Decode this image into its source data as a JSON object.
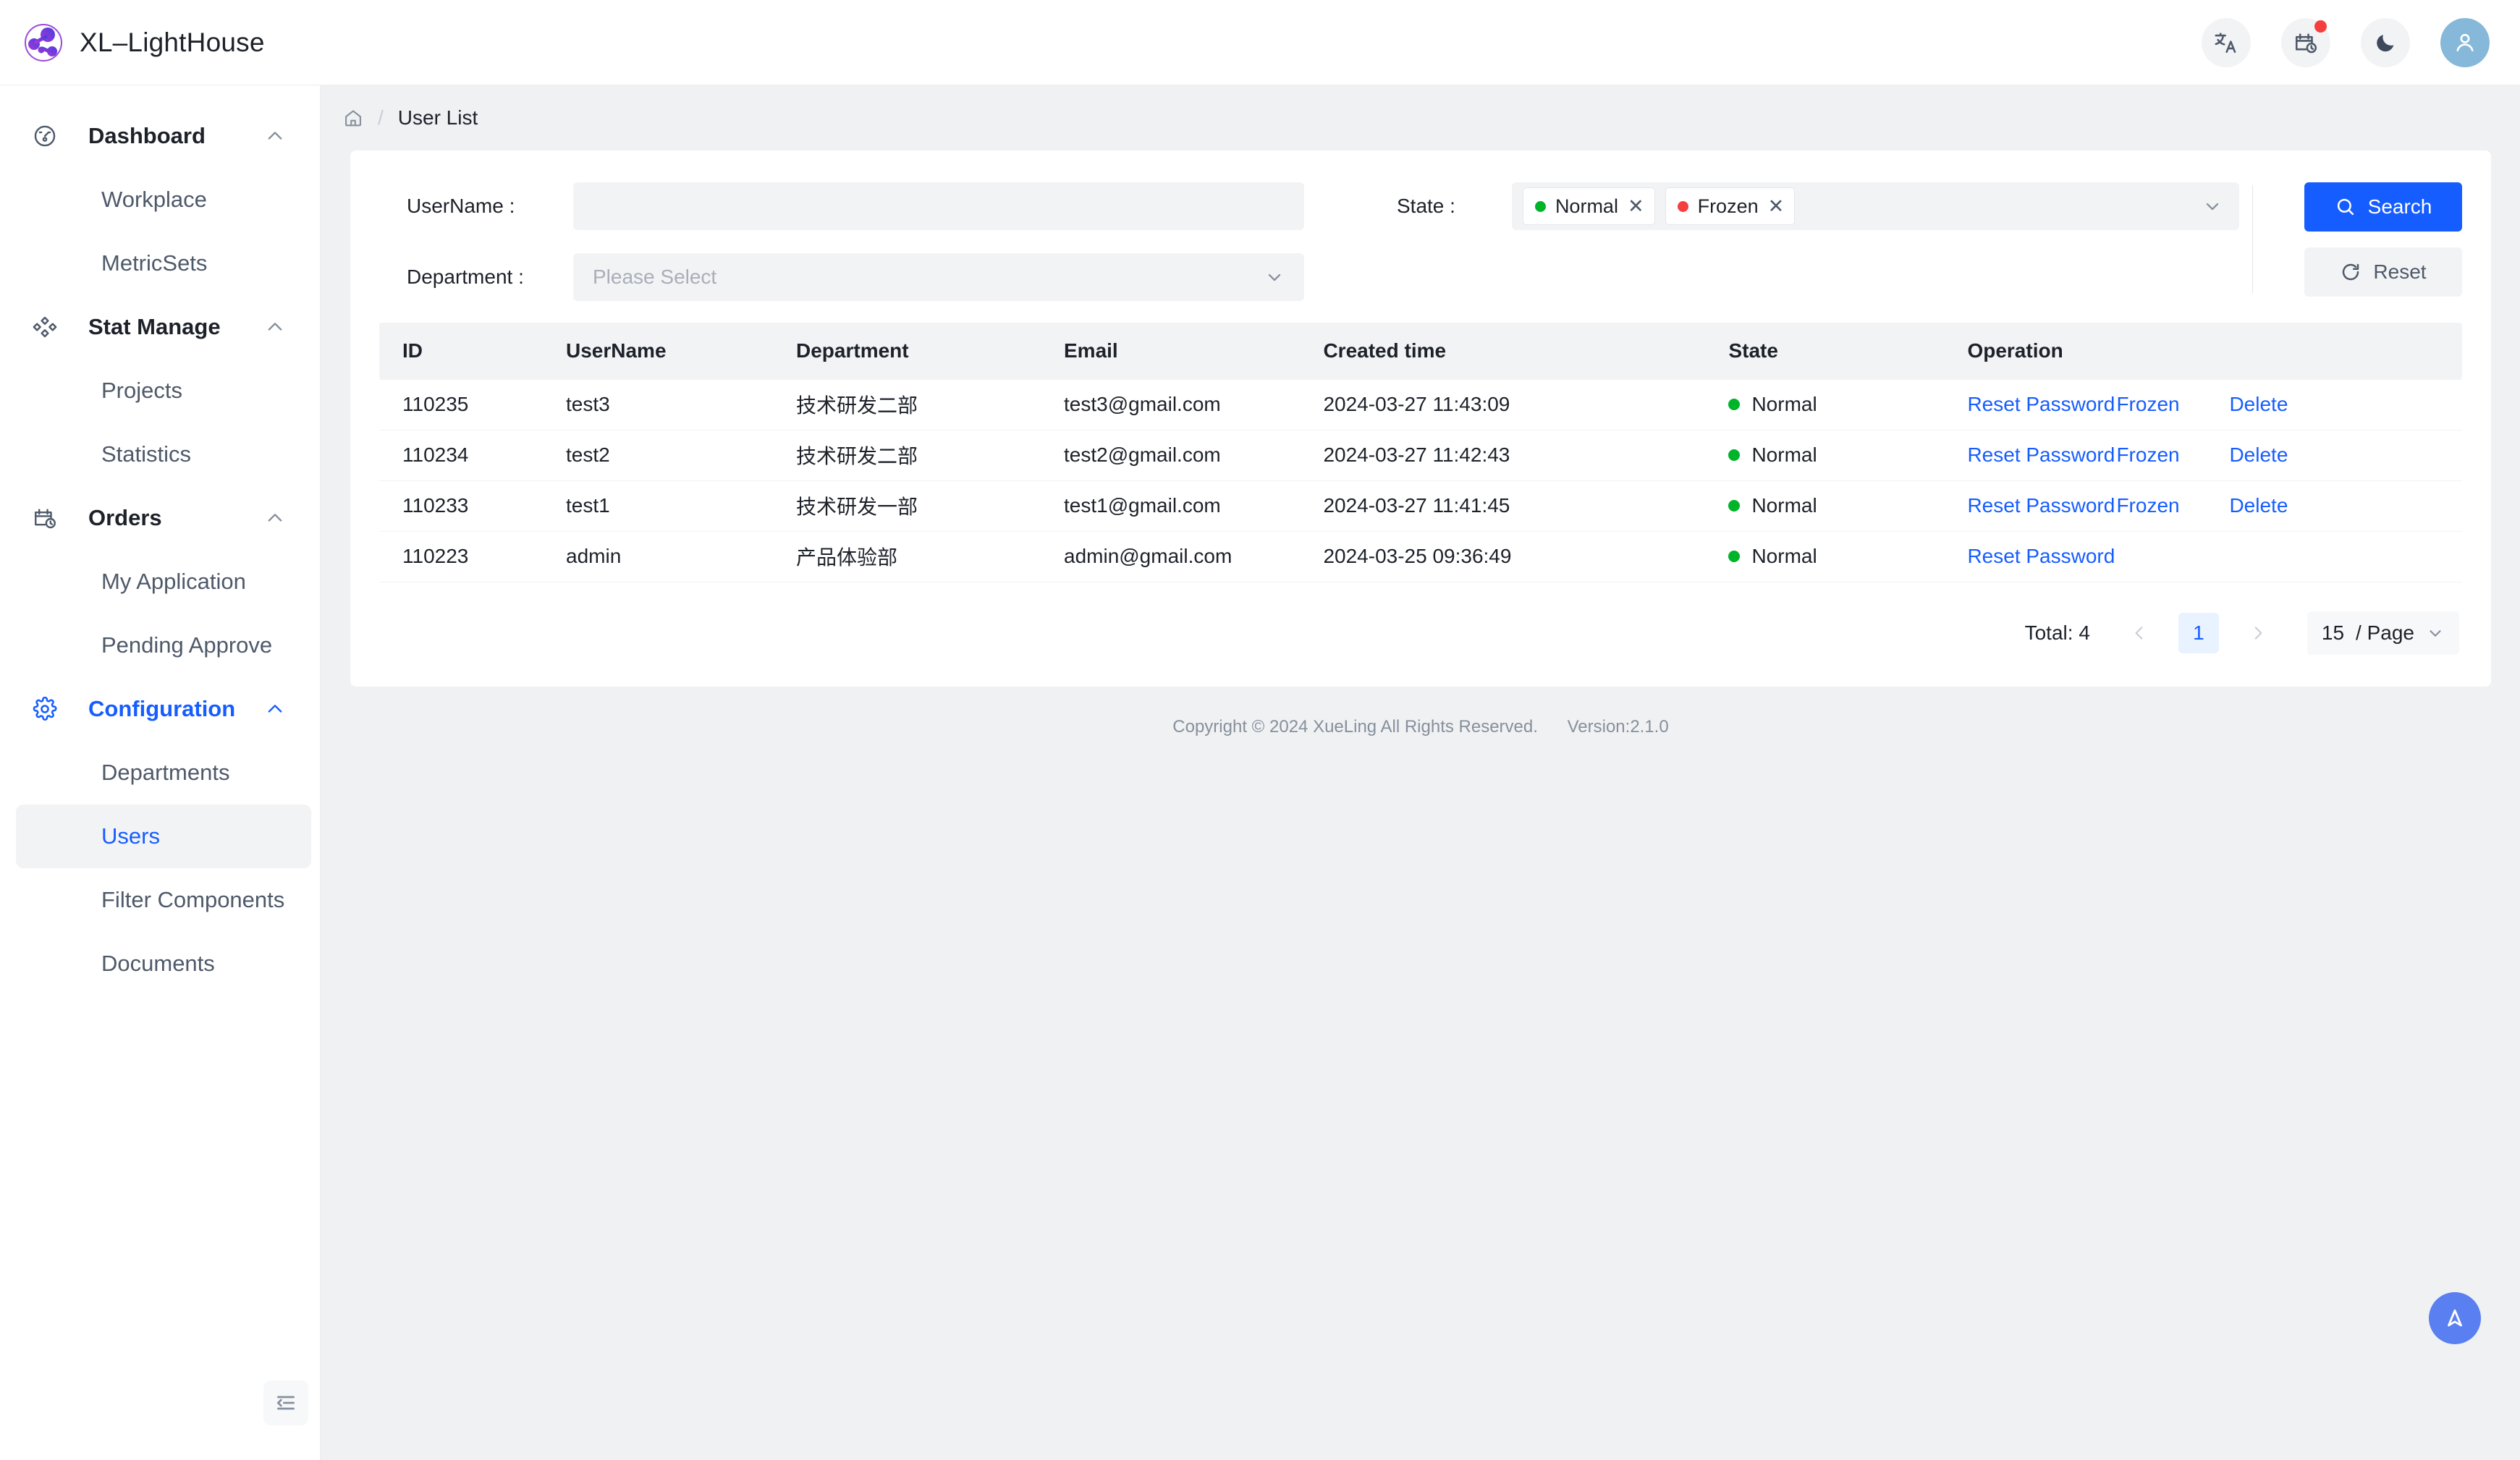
{
  "app": {
    "brand_title": "XL–LightHouse"
  },
  "header": {
    "icons": [
      {
        "name": "translate-icon"
      },
      {
        "name": "calendar-clock-icon",
        "has_badge": true
      },
      {
        "name": "moon-icon"
      },
      {
        "name": "user-avatar-icon"
      }
    ]
  },
  "sidebar": {
    "groups": [
      {
        "label": "Dashboard",
        "icon": "dashboard-icon",
        "active": false,
        "items": [
          {
            "label": "Workplace",
            "active": false
          },
          {
            "label": "MetricSets",
            "active": false
          }
        ]
      },
      {
        "label": "Stat Manage",
        "icon": "stat-manage-icon",
        "active": false,
        "items": [
          {
            "label": "Projects",
            "active": false
          },
          {
            "label": "Statistics",
            "active": false
          }
        ]
      },
      {
        "label": "Orders",
        "icon": "orders-icon",
        "active": false,
        "items": [
          {
            "label": "My Application",
            "active": false
          },
          {
            "label": "Pending Approve",
            "active": false
          }
        ]
      },
      {
        "label": "Configuration",
        "icon": "gear-icon",
        "active": true,
        "items": [
          {
            "label": "Departments",
            "active": false
          },
          {
            "label": "Users",
            "active": true
          },
          {
            "label": "Filter Components",
            "active": false
          },
          {
            "label": "Documents",
            "active": false
          }
        ]
      }
    ],
    "collapse_icon": "menu-fold-icon"
  },
  "breadcrumb": {
    "home_icon": "home-icon",
    "separator": "/",
    "current": "User List"
  },
  "filter": {
    "username": {
      "label": "UserName :",
      "value": "",
      "placeholder": ""
    },
    "department": {
      "label": "Department :",
      "value": "",
      "placeholder": "Please Select"
    },
    "state": {
      "label": "State :",
      "tags": [
        {
          "label": "Normal",
          "dot_color": "#00b42a",
          "close": "✕"
        },
        {
          "label": "Frozen",
          "dot_color": "#f53f3f",
          "close": "✕"
        }
      ]
    },
    "search_button": "Search",
    "reset_button": "Reset"
  },
  "table": {
    "columns": [
      "ID",
      "UserName",
      "Department",
      "Email",
      "Created time",
      "State",
      "Operation"
    ],
    "rows": [
      {
        "id": "110235",
        "username": "test3",
        "department": "技术研发二部",
        "email": "test3@gmail.com",
        "created_time": "2024-03-27 11:43:09",
        "state": "Normal",
        "state_color": "#00b42a",
        "operations": [
          "Reset Password",
          "Frozen",
          "Delete"
        ]
      },
      {
        "id": "110234",
        "username": "test2",
        "department": "技术研发二部",
        "email": "test2@gmail.com",
        "created_time": "2024-03-27 11:42:43",
        "state": "Normal",
        "state_color": "#00b42a",
        "operations": [
          "Reset Password",
          "Frozen",
          "Delete"
        ]
      },
      {
        "id": "110233",
        "username": "test1",
        "department": "技术研发一部",
        "email": "test1@gmail.com",
        "created_time": "2024-03-27 11:41:45",
        "state": "Normal",
        "state_color": "#00b42a",
        "operations": [
          "Reset Password",
          "Frozen",
          "Delete"
        ]
      },
      {
        "id": "110223",
        "username": "admin",
        "department": "产品体验部",
        "email": "admin@gmail.com",
        "created_time": "2024-03-25 09:36:49",
        "state": "Normal",
        "state_color": "#00b42a",
        "operations": [
          "Reset Password"
        ]
      }
    ]
  },
  "pagination": {
    "total_label": "Total: 4",
    "prev_icon": "chevron-left-icon",
    "current_page": "1",
    "next_icon": "chevron-right-icon",
    "page_size": "15",
    "page_size_suffix": "/ Page"
  },
  "footer": {
    "copyright": "Copyright © 2024 XueLing All Rights Reserved.",
    "version": "Version:2.1.0"
  },
  "fab": {
    "name": "scroll-to-top-button"
  },
  "colors": {
    "primary": "#165dff",
    "success": "#00b42a",
    "danger": "#f53f3f",
    "page_bg": "#f0f1f3",
    "surface": "#ffffff"
  }
}
